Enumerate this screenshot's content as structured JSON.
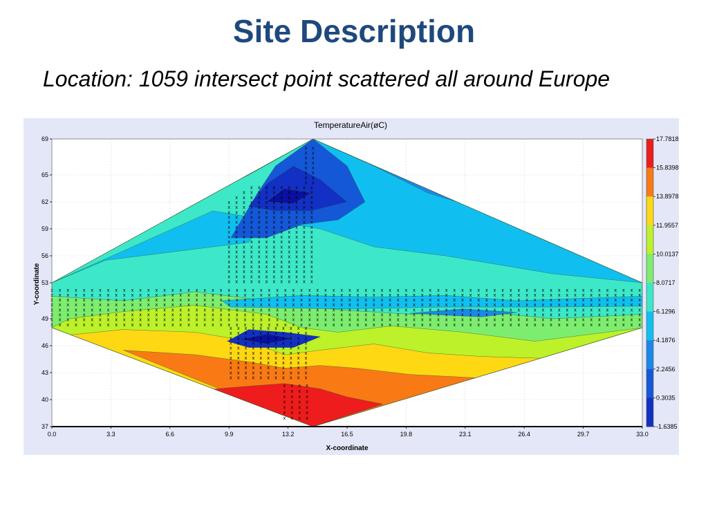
{
  "slide": {
    "title": "Site Description",
    "subtitle": "Location: 1059 intersect point scattered all around Europe"
  },
  "chart_data": {
    "type": "heatmap",
    "title": "TemperatureAir(øC)",
    "xlabel": "X-coordinate",
    "ylabel": "Y-coordinate",
    "xlim": [
      0.0,
      33.0
    ],
    "ylim": [
      37,
      69
    ],
    "x_ticks": [
      "0.0",
      "3.3",
      "6.6",
      "9.9",
      "13.2",
      "16.5",
      "19.8",
      "23.1",
      "26.4",
      "29.7",
      "33.0"
    ],
    "y_ticks": [
      "37",
      "40",
      "43",
      "46",
      "49",
      "53",
      "56",
      "59",
      "62",
      "65",
      "69"
    ],
    "grid": true,
    "legend_position": "right",
    "colorbar": {
      "labels": [
        "17.7818",
        "15.8398",
        "13.8978",
        "11.9557",
        "10.0137",
        "8.0717",
        "6.1296",
        "4.1876",
        "2.2456",
        "0.3035",
        "-1.6385"
      ],
      "colors": [
        "#ee1c1c",
        "#f97a14",
        "#ffd814",
        "#bdf12a",
        "#7ded6f",
        "#3ce8c8",
        "#10bff0",
        "#1a88ea",
        "#1458d8",
        "#1230c4",
        "#0a10a0"
      ]
    },
    "domain_outline": [
      [
        0.0,
        53
      ],
      [
        14.6,
        69
      ],
      [
        33.0,
        53
      ],
      [
        33.0,
        48
      ],
      [
        14.6,
        37
      ],
      [
        0.0,
        48
      ]
    ],
    "sample_marker": "x",
    "sample_count": 1059
  }
}
